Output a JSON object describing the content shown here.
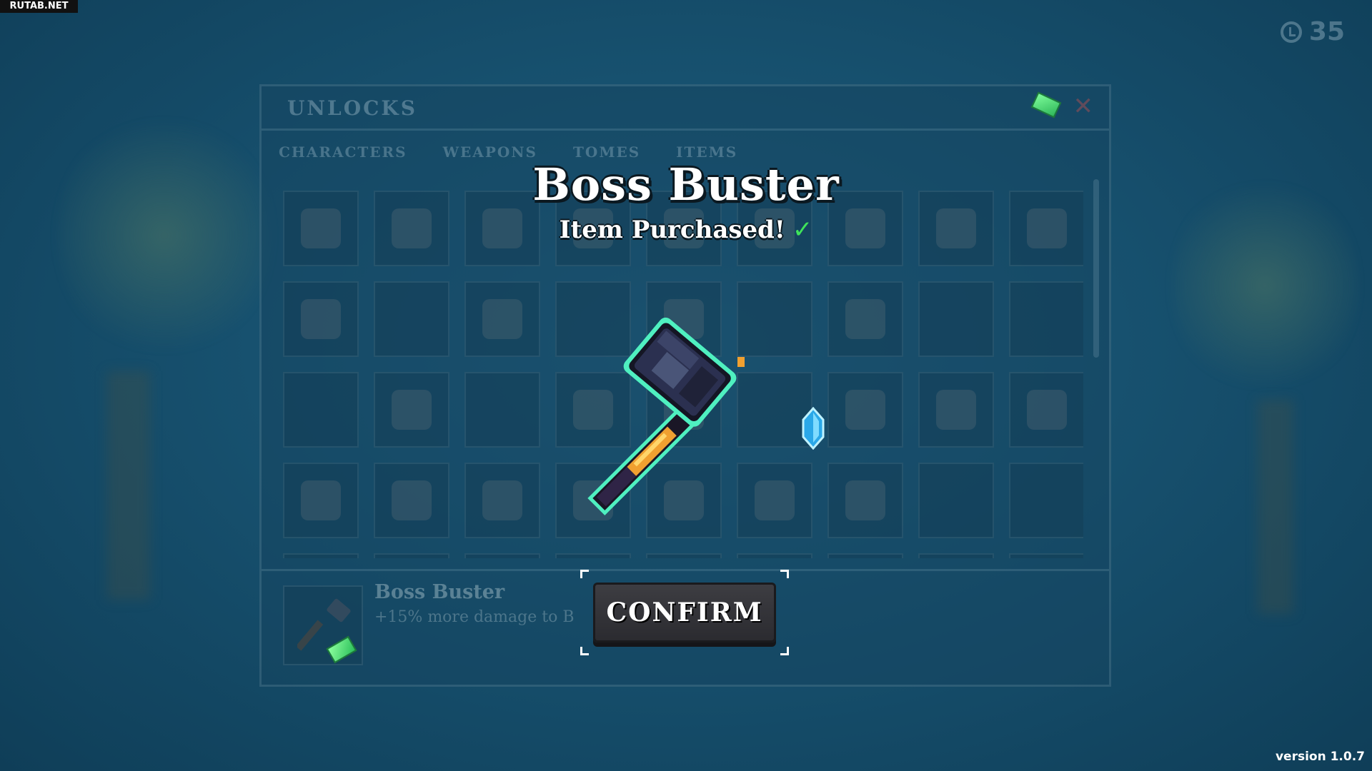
{
  "watermark": "RUTAB.NET",
  "top_counter": {
    "value": "35",
    "icon": "clock-icon"
  },
  "version": "version 1.0.7",
  "panel": {
    "title": "UNLOCKS",
    "header_icon": "gem-icon",
    "close_icon": "close-icon",
    "tabs": [
      "CHARACTERS",
      "WEAPONS",
      "TOMES",
      "ITEMS"
    ],
    "footer": {
      "item_name": "Boss Buster",
      "item_desc": "+15% more damage to B",
      "item_icon": "hammer-icon",
      "gem_icon": "gem-icon"
    }
  },
  "popup": {
    "title": "Boss Buster",
    "subtitle": "Item Purchased!",
    "check": "✓",
    "item_icon": "hammer-icon",
    "sparkle_icon": "crystal-icon",
    "confirm_label": "CONFIRM"
  },
  "colors": {
    "background": "#1a5674",
    "gem": "#4fe07a",
    "check": "#3fe35a",
    "button": "#34343a",
    "hammer_outline": "#4ff0c0"
  }
}
